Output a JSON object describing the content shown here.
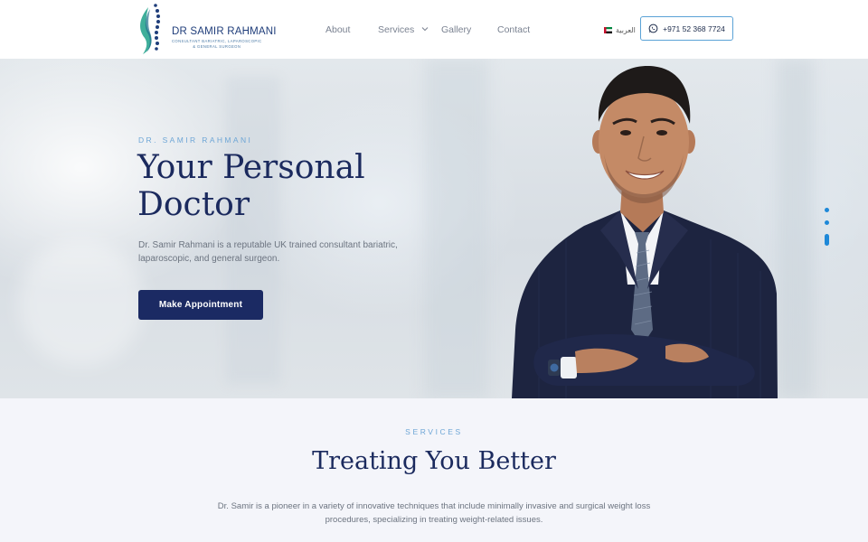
{
  "header": {
    "logo": {
      "name": "DR SAMIR RAHMANI",
      "tagline_line1": "CONSULTANT BARIATRIC, LAPAROSCOPIC",
      "tagline_line2": "& GENERAL SURGEON"
    },
    "nav": {
      "about": "About",
      "services": "Services",
      "gallery": "Gallery",
      "contact": "Contact"
    },
    "language": {
      "label": "العربية",
      "flag_icon": "uae-flag-icon"
    },
    "phone": {
      "label": "+971 52 368 7724",
      "icon": "whatsapp-icon"
    }
  },
  "hero": {
    "eyebrow": "DR. SAMIR RAHMANI",
    "title_line1": "Your Personal",
    "title_line2": "Doctor",
    "description": "Dr. Samir Rahmani is a reputable UK trained consultant bariatric, laparoscopic, and general surgeon.",
    "cta_label": "Make Appointment",
    "slider_active_index": 3,
    "slider_count": 3
  },
  "services": {
    "eyebrow": "SERVICES",
    "title": "Treating You Better",
    "description": "Dr. Samir is a pioneer in a variety of innovative techniques that include minimally invasive and surgical weight loss procedures, specializing in treating weight-related issues."
  },
  "colors": {
    "navy": "#1b2a63",
    "accent_blue": "#6ea6d6",
    "dot_blue": "#1e88d8",
    "teal": "#3fae9a"
  }
}
